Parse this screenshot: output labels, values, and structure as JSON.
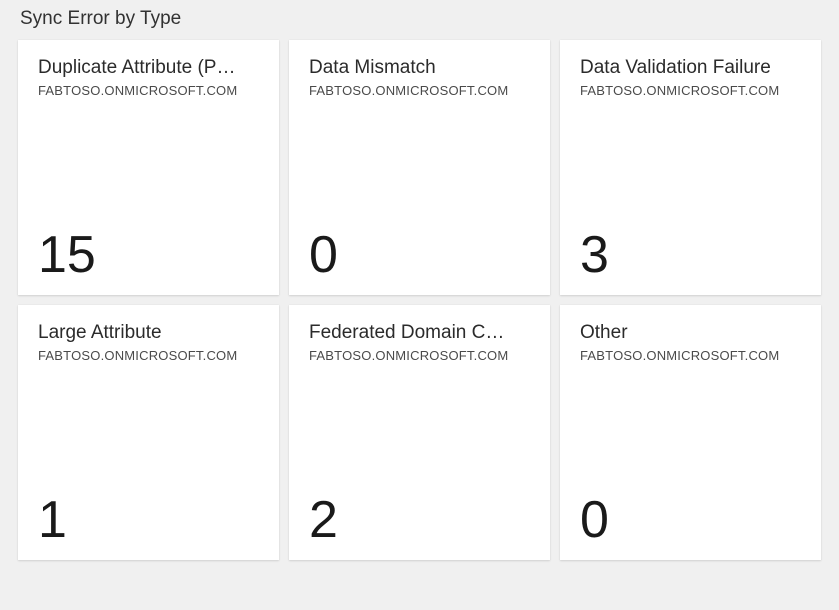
{
  "page": {
    "title": "Sync Error by Type"
  },
  "tiles": [
    {
      "title": "Duplicate Attribute (P…",
      "subtitle": "FABTOSO.ONMICROSOFT.COM",
      "value": "15"
    },
    {
      "title": "Data Mismatch",
      "subtitle": "FABTOSO.ONMICROSOFT.COM",
      "value": "0"
    },
    {
      "title": "Data Validation Failure",
      "subtitle": "FABTOSO.ONMICROSOFT.COM",
      "value": "3"
    },
    {
      "title": "Large Attribute",
      "subtitle": "FABTOSO.ONMICROSOFT.COM",
      "value": "1"
    },
    {
      "title": "Federated Domain C…",
      "subtitle": "FABTOSO.ONMICROSOFT.COM",
      "value": "2"
    },
    {
      "title": "Other",
      "subtitle": "FABTOSO.ONMICROSOFT.COM",
      "value": "0"
    }
  ]
}
